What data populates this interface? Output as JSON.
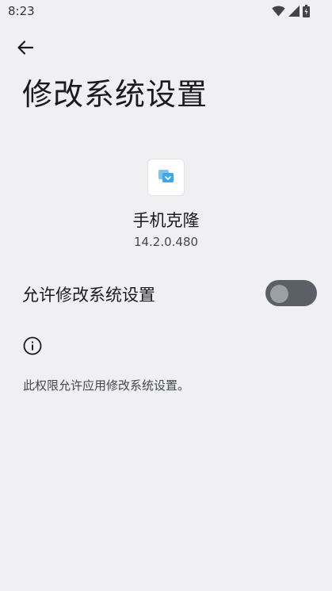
{
  "status_bar": {
    "time": "8:23",
    "icons": [
      "wifi-icon",
      "cell-signal-icon",
      "battery-charging-icon"
    ]
  },
  "header": {
    "back_icon": "arrow-back-icon",
    "title": "修改系统设置"
  },
  "app": {
    "icon": "phone-clone-app-icon",
    "name": "手机克隆",
    "version": "14.2.0.480"
  },
  "setting": {
    "label": "允许修改系统设置",
    "enabled": false
  },
  "info": {
    "icon": "info-icon",
    "text": "此权限允许应用修改系统设置。"
  },
  "colors": {
    "background": "#f0f0f3",
    "switch_track_off": "#5b5f66",
    "switch_thumb_off": "#9aa0a6",
    "app_icon_accent": "#3fa7e8"
  }
}
